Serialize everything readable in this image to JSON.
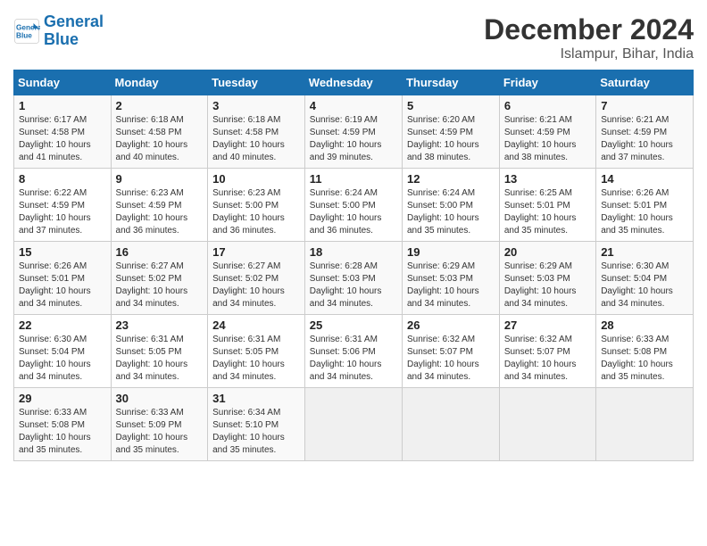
{
  "header": {
    "logo_line1": "General",
    "logo_line2": "Blue",
    "title": "December 2024",
    "subtitle": "Islampur, Bihar, India"
  },
  "calendar": {
    "days_of_week": [
      "Sunday",
      "Monday",
      "Tuesday",
      "Wednesday",
      "Thursday",
      "Friday",
      "Saturday"
    ],
    "weeks": [
      [
        {
          "day": "",
          "info": ""
        },
        {
          "day": "2",
          "info": "Sunrise: 6:18 AM\nSunset: 4:58 PM\nDaylight: 10 hours\nand 40 minutes."
        },
        {
          "day": "3",
          "info": "Sunrise: 6:18 AM\nSunset: 4:58 PM\nDaylight: 10 hours\nand 40 minutes."
        },
        {
          "day": "4",
          "info": "Sunrise: 6:19 AM\nSunset: 4:59 PM\nDaylight: 10 hours\nand 39 minutes."
        },
        {
          "day": "5",
          "info": "Sunrise: 6:20 AM\nSunset: 4:59 PM\nDaylight: 10 hours\nand 38 minutes."
        },
        {
          "day": "6",
          "info": "Sunrise: 6:21 AM\nSunset: 4:59 PM\nDaylight: 10 hours\nand 38 minutes."
        },
        {
          "day": "7",
          "info": "Sunrise: 6:21 AM\nSunset: 4:59 PM\nDaylight: 10 hours\nand 37 minutes."
        }
      ],
      [
        {
          "day": "1",
          "info": "Sunrise: 6:17 AM\nSunset: 4:58 PM\nDaylight: 10 hours\nand 41 minutes."
        },
        {
          "day": "8",
          "info": "Sunrise: 6:22 AM\nSunset: 4:59 PM\nDaylight: 10 hours\nand 37 minutes."
        },
        {
          "day": "9",
          "info": "Sunrise: 6:23 AM\nSunset: 4:59 PM\nDaylight: 10 hours\nand 36 minutes."
        },
        {
          "day": "10",
          "info": "Sunrise: 6:23 AM\nSunset: 5:00 PM\nDaylight: 10 hours\nand 36 minutes."
        },
        {
          "day": "11",
          "info": "Sunrise: 6:24 AM\nSunset: 5:00 PM\nDaylight: 10 hours\nand 36 minutes."
        },
        {
          "day": "12",
          "info": "Sunrise: 6:24 AM\nSunset: 5:00 PM\nDaylight: 10 hours\nand 35 minutes."
        },
        {
          "day": "13",
          "info": "Sunrise: 6:25 AM\nSunset: 5:01 PM\nDaylight: 10 hours\nand 35 minutes."
        },
        {
          "day": "14",
          "info": "Sunrise: 6:26 AM\nSunset: 5:01 PM\nDaylight: 10 hours\nand 35 minutes."
        }
      ],
      [
        {
          "day": "15",
          "info": "Sunrise: 6:26 AM\nSunset: 5:01 PM\nDaylight: 10 hours\nand 34 minutes."
        },
        {
          "day": "16",
          "info": "Sunrise: 6:27 AM\nSunset: 5:02 PM\nDaylight: 10 hours\nand 34 minutes."
        },
        {
          "day": "17",
          "info": "Sunrise: 6:27 AM\nSunset: 5:02 PM\nDaylight: 10 hours\nand 34 minutes."
        },
        {
          "day": "18",
          "info": "Sunrise: 6:28 AM\nSunset: 5:03 PM\nDaylight: 10 hours\nand 34 minutes."
        },
        {
          "day": "19",
          "info": "Sunrise: 6:29 AM\nSunset: 5:03 PM\nDaylight: 10 hours\nand 34 minutes."
        },
        {
          "day": "20",
          "info": "Sunrise: 6:29 AM\nSunset: 5:03 PM\nDaylight: 10 hours\nand 34 minutes."
        },
        {
          "day": "21",
          "info": "Sunrise: 6:30 AM\nSunset: 5:04 PM\nDaylight: 10 hours\nand 34 minutes."
        }
      ],
      [
        {
          "day": "22",
          "info": "Sunrise: 6:30 AM\nSunset: 5:04 PM\nDaylight: 10 hours\nand 34 minutes."
        },
        {
          "day": "23",
          "info": "Sunrise: 6:31 AM\nSunset: 5:05 PM\nDaylight: 10 hours\nand 34 minutes."
        },
        {
          "day": "24",
          "info": "Sunrise: 6:31 AM\nSunset: 5:05 PM\nDaylight: 10 hours\nand 34 minutes."
        },
        {
          "day": "25",
          "info": "Sunrise: 6:31 AM\nSunset: 5:06 PM\nDaylight: 10 hours\nand 34 minutes."
        },
        {
          "day": "26",
          "info": "Sunrise: 6:32 AM\nSunset: 5:07 PM\nDaylight: 10 hours\nand 34 minutes."
        },
        {
          "day": "27",
          "info": "Sunrise: 6:32 AM\nSunset: 5:07 PM\nDaylight: 10 hours\nand 34 minutes."
        },
        {
          "day": "28",
          "info": "Sunrise: 6:33 AM\nSunset: 5:08 PM\nDaylight: 10 hours\nand 35 minutes."
        }
      ],
      [
        {
          "day": "29",
          "info": "Sunrise: 6:33 AM\nSunset: 5:08 PM\nDaylight: 10 hours\nand 35 minutes."
        },
        {
          "day": "30",
          "info": "Sunrise: 6:33 AM\nSunset: 5:09 PM\nDaylight: 10 hours\nand 35 minutes."
        },
        {
          "day": "31",
          "info": "Sunrise: 6:34 AM\nSunset: 5:10 PM\nDaylight: 10 hours\nand 35 minutes."
        },
        {
          "day": "",
          "info": ""
        },
        {
          "day": "",
          "info": ""
        },
        {
          "day": "",
          "info": ""
        },
        {
          "day": "",
          "info": ""
        }
      ]
    ]
  }
}
